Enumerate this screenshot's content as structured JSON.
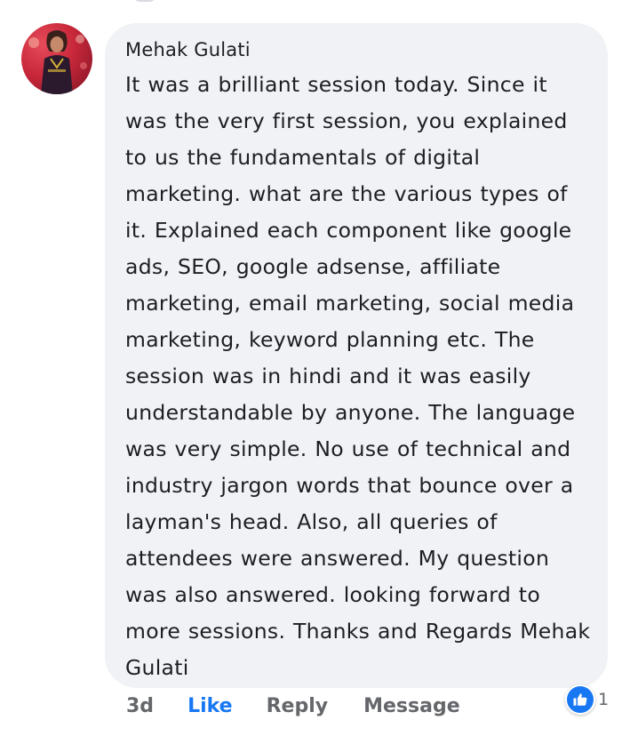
{
  "comment": {
    "author": "Mehak Gulati",
    "text": "It was a brilliant session today. Since it was the very first session, you explained to us the fundamentals of digital marketing. what are the various types of it. Explained each component like google ads, SEO, google adsense, affiliate marketing, email marketing, social media marketing, keyword planning etc. The session was in hindi and it was easily understandable by anyone. The language was very simple. No use of technical and industry jargon words that bounce over a layman's head. Also, all queries of attendees were answered. My question was also answered. looking forward to more sessions. Thanks and Regards Mehak Gulati",
    "avatar_icon": "profile-photo"
  },
  "actions": {
    "time": "3d",
    "like_label": "Like",
    "reply_label": "Reply",
    "message_label": "Message"
  },
  "reactions": {
    "icon": "thumbs-up-icon",
    "count": "1"
  },
  "colors": {
    "bubble_bg": "#f0f2f5",
    "like_blue": "#1877f2",
    "meta_gray": "#65676b",
    "text": "#1c1e21"
  }
}
